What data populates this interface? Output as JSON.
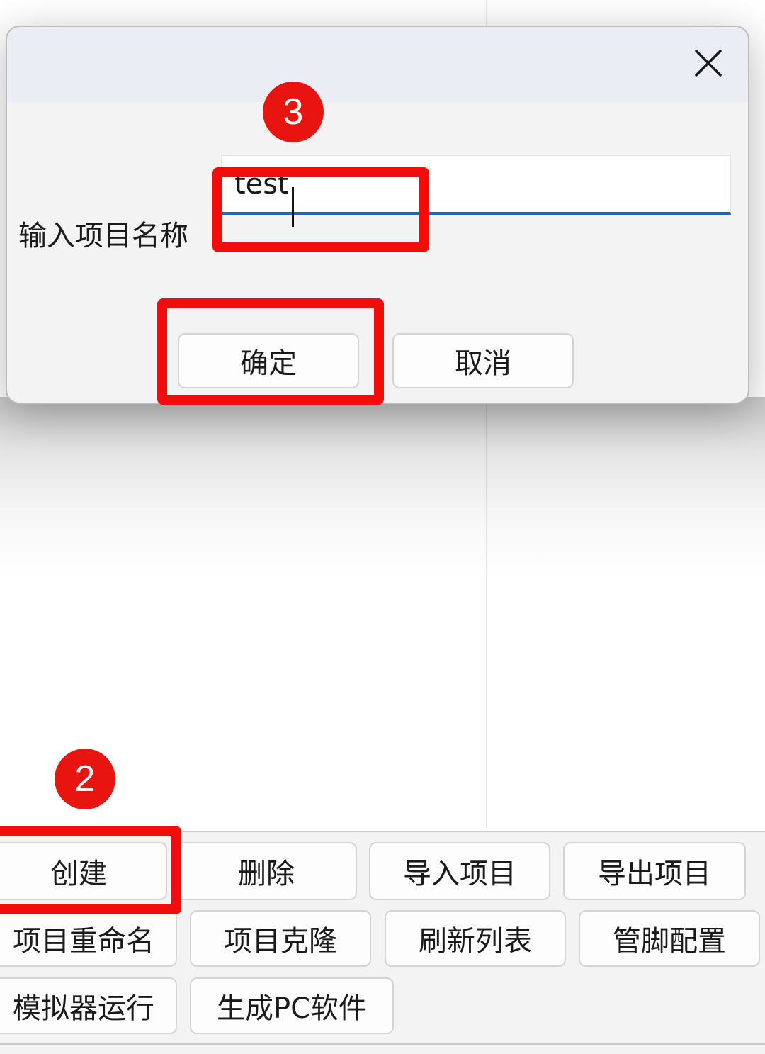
{
  "dialog": {
    "field_label": "输入项目名称",
    "input_value": "test",
    "confirm_label": "确定",
    "cancel_label": "取消",
    "close_icon": "close-icon"
  },
  "toolbar": {
    "row1": [
      "创建",
      "删除",
      "导入项目",
      "导出项目"
    ],
    "row2": [
      "项目重命名",
      "项目克隆",
      "刷新列表",
      "管脚配置"
    ],
    "row3": [
      "模拟器运行",
      "生成PC软件"
    ]
  },
  "annotations": {
    "step_input_confirm": "3",
    "step_create": "2",
    "highlight_color": "#f20d0d"
  }
}
